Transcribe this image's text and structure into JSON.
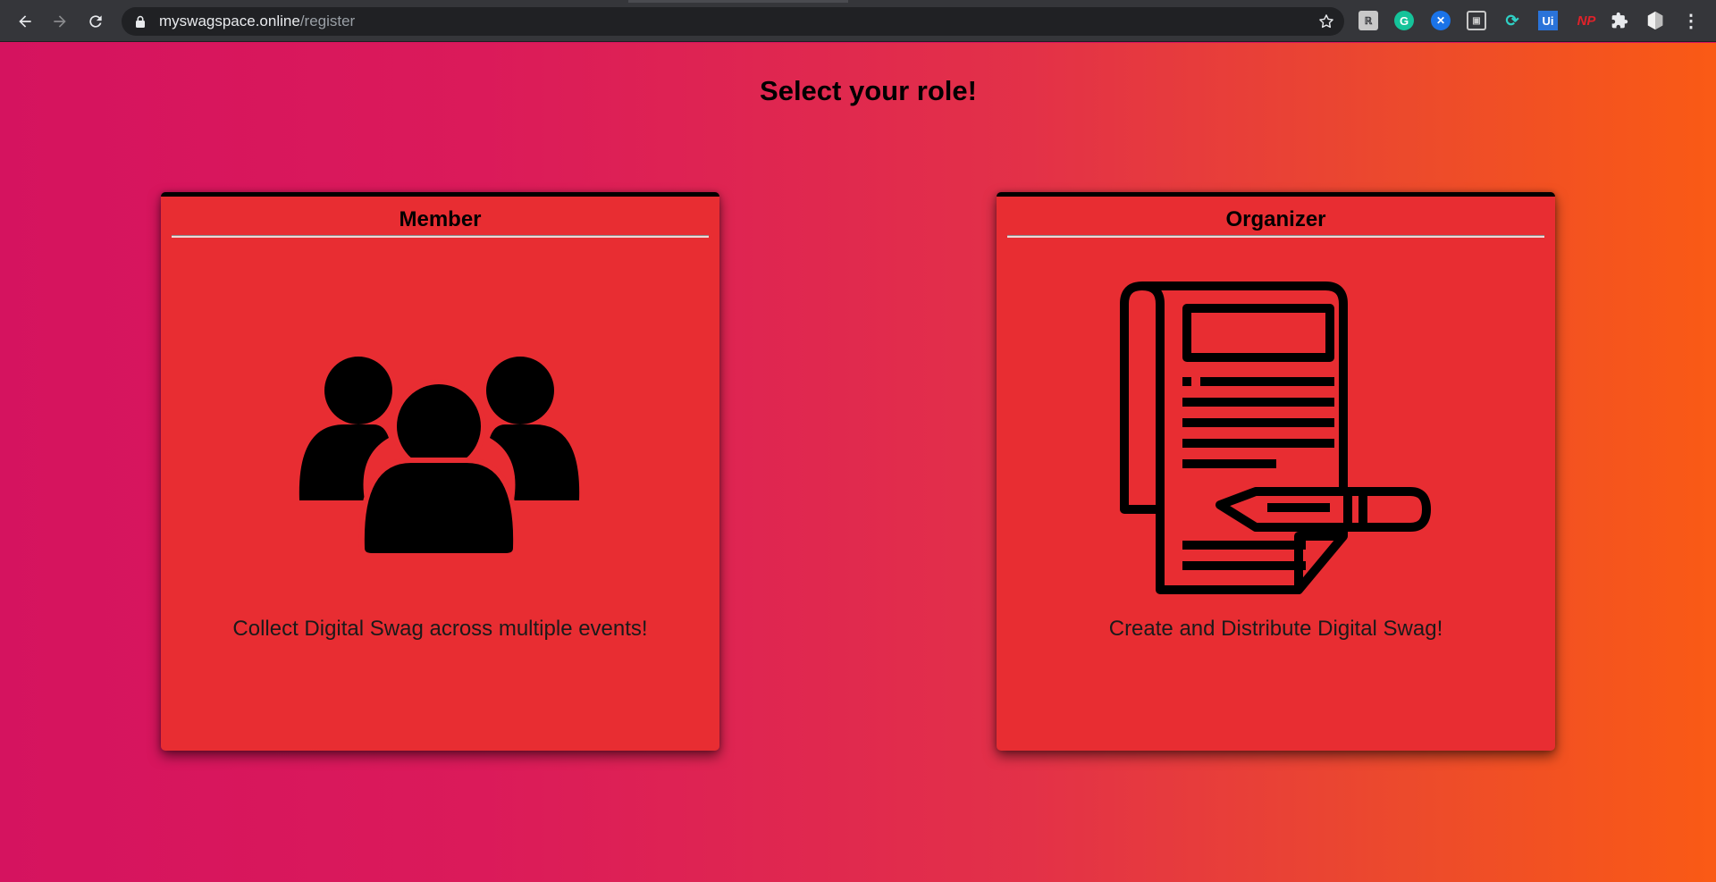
{
  "browser": {
    "url_host": "myswagspace.online",
    "url_path": "/register",
    "extensions": [
      {
        "icon": "reader-extension-icon",
        "label": "",
        "color": "#c8c8c8"
      },
      {
        "icon": "grammarly-icon",
        "label": "G",
        "color": "#15c39a"
      },
      {
        "icon": "translate-extension-icon",
        "label": "",
        "color": "#1a73e8"
      },
      {
        "icon": "tab-manager-icon",
        "label": "",
        "color": "#c8c8c8"
      },
      {
        "icon": "sync-extension-icon",
        "label": "",
        "color": "#2fd0c5"
      },
      {
        "icon": "uipath-icon",
        "label": "Ui",
        "color": "#2a73d9"
      },
      {
        "icon": "np-extension-icon",
        "label": "NP",
        "color": "#e0222a"
      }
    ]
  },
  "page": {
    "title": "Select your role!",
    "cards": [
      {
        "title": "Member",
        "description": "Collect Digital Swag across multiple events!",
        "icon": "people-group-icon"
      },
      {
        "title": "Organizer",
        "description": "Create and Distribute Digital Swag!",
        "icon": "document-pencil-icon"
      }
    ]
  },
  "colors": {
    "gradient_start": "#d5135f",
    "gradient_end": "#fa5a15",
    "card_background": "#e82d32",
    "chrome_background": "#35363a"
  }
}
